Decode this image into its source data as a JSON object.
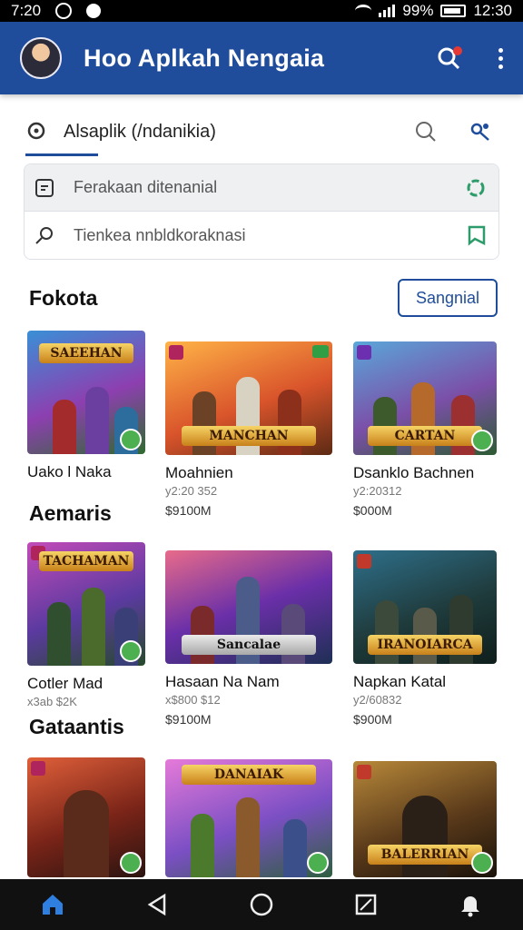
{
  "status_bar": {
    "time": "7:20",
    "battery": "99%",
    "clock_right": "12:30"
  },
  "app_bar": {
    "title": "Hoo Aplkah Nengaia"
  },
  "search": {
    "text": "Alsaplik (/ndanikia)"
  },
  "filters": [
    {
      "label": "Ferakaan ditenanial"
    },
    {
      "label": "Tienkea nnbldkoraknasi"
    }
  ],
  "sections": [
    {
      "title": "Fokota",
      "action": "Sangnial"
    },
    {
      "title": "Aemaris"
    },
    {
      "title": "Gataantis"
    }
  ],
  "cards_row1": [
    {
      "title": "Uako l Naka",
      "sub": "",
      "price": "",
      "logo": "SAEEHAN"
    },
    {
      "title": "Moahnien",
      "sub": "y2:20 352",
      "price": "$9100M",
      "logo": "MANCHAN"
    },
    {
      "title": "Dsanklo Bachnen",
      "sub": "y2:20312",
      "price": "$000M",
      "logo": "CARTAN"
    }
  ],
  "cards_row2": [
    {
      "title": "Cotler Mad",
      "sub": "x3ab $2K",
      "price": "",
      "logo": "TACHAMAN"
    },
    {
      "title": "Hasaan Na Nam",
      "sub": "x$800 $12",
      "price": "$9100M",
      "logo": "Sancalae"
    },
    {
      "title": "Napkan Katal",
      "sub": "y2/60832",
      "price": "$900M",
      "logo": "IRANOIARCA"
    }
  ],
  "cards_row3": [
    {
      "logo": ""
    },
    {
      "logo": "DANAIAK"
    },
    {
      "logo": "BALERRIAN"
    }
  ],
  "colors": {
    "primary": "#1f4d9c",
    "accent_green": "#4caf50"
  },
  "nav": [
    "home-icon",
    "back-icon",
    "home-circle-icon",
    "recents-icon",
    "notifications-icon"
  ]
}
